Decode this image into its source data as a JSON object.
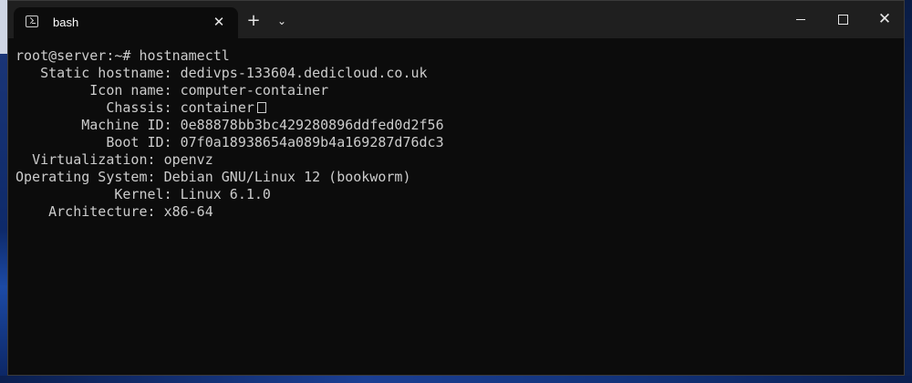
{
  "window": {
    "tab_title": "bash",
    "new_tab_symbol": "+",
    "dropdown_symbol": "⌄",
    "close_symbol": "✕",
    "minimize_symbol": "—",
    "maximize_symbol": "□",
    "window_close_symbol": "✕"
  },
  "terminal": {
    "prompt": "root@server:~# ",
    "command": "hostnamectl",
    "lines": [
      {
        "label": "Static hostname",
        "value": "dedivps-133604.dedicloud.co.uk"
      },
      {
        "label": "Icon name",
        "value": "computer-container"
      },
      {
        "label": "Chassis",
        "value": "container"
      },
      {
        "label": "Machine ID",
        "value": "0e88878bb3bc429280896ddfed0d2f56"
      },
      {
        "label": "Boot ID",
        "value": "07f0a18938654a089b4a169287d76dc3"
      },
      {
        "label": "Virtualization",
        "value": "openvz"
      },
      {
        "label": "Operating System",
        "value": "Debian GNU/Linux 12 (bookworm)"
      },
      {
        "label": "Kernel",
        "value": "Linux 6.1.0"
      },
      {
        "label": "Architecture",
        "value": "x86-64"
      }
    ]
  },
  "colors": {
    "terminal_bg": "#0c0c0c",
    "titlebar_bg": "#1f1f1f",
    "text": "#cccccc",
    "white": "#ffffff"
  }
}
